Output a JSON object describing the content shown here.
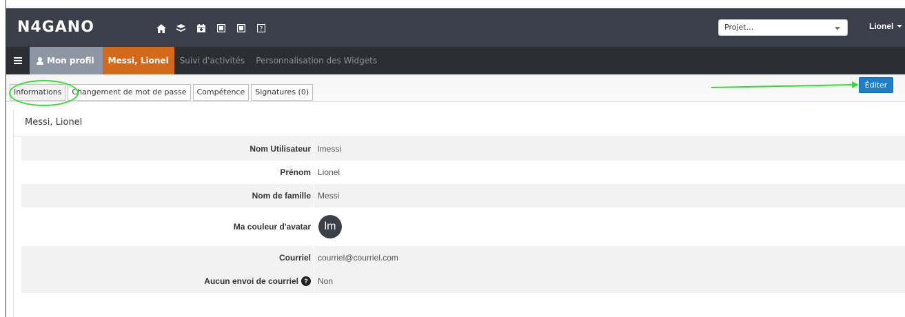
{
  "app": {
    "logo": "N4GANO",
    "nav_icons": [
      "home-icon",
      "layers-icon",
      "calendar-icon",
      "dollar-icon-1",
      "dollar-icon-2",
      "help-icon"
    ],
    "project_select": {
      "value": "Projet..."
    },
    "user_menu": "Lionel"
  },
  "subnav": {
    "items": [
      {
        "label": "Mon profil"
      },
      {
        "label": "Messi, Lionel"
      },
      {
        "label": "Suivi d'activités"
      },
      {
        "label": "Personnalisation des Widgets"
      }
    ]
  },
  "tabs": [
    {
      "label": "Informations"
    },
    {
      "label": "Changement de mot de passe"
    },
    {
      "label": "Compétence"
    },
    {
      "label": "Signatures (0)"
    }
  ],
  "toolbar": {
    "edit_label": "Éditer"
  },
  "panel": {
    "title": "Messi, Lionel",
    "rows": [
      {
        "label": "Nom Utilisateur",
        "value": "lmessi"
      },
      {
        "label": "Prénom",
        "value": "Lionel"
      },
      {
        "label": "Nom de famille",
        "value": "Messi"
      },
      {
        "label": "Ma couleur d'avatar",
        "value": "lm"
      },
      {
        "label": "Courriel",
        "value": "courriel@courriel.com"
      },
      {
        "label": "Aucun envoi de courriel",
        "value": "Non"
      }
    ]
  },
  "colors": {
    "topbar": "#3a3f49",
    "subbar": "#2b2e34",
    "active_tab": "#d36a1b",
    "profile_tab": "#8e96a4",
    "edit_button": "#1f7fc6",
    "annotation": "#33dd33"
  }
}
